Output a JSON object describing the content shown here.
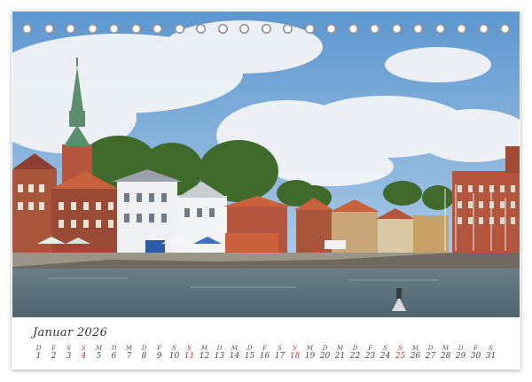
{
  "calendar": {
    "month_label": "Januar 2026",
    "ring_count": 23,
    "sunday_color": "#c0392b",
    "days": [
      {
        "wd": "D",
        "n": "1"
      },
      {
        "wd": "F",
        "n": "2"
      },
      {
        "wd": "S",
        "n": "3"
      },
      {
        "wd": "S",
        "n": "4",
        "sunday": true
      },
      {
        "wd": "M",
        "n": "5"
      },
      {
        "wd": "D",
        "n": "6"
      },
      {
        "wd": "M",
        "n": "7"
      },
      {
        "wd": "D",
        "n": "8"
      },
      {
        "wd": "F",
        "n": "9"
      },
      {
        "wd": "S",
        "n": "10"
      },
      {
        "wd": "S",
        "n": "11",
        "sunday": true
      },
      {
        "wd": "M",
        "n": "12"
      },
      {
        "wd": "D",
        "n": "13"
      },
      {
        "wd": "M",
        "n": "14"
      },
      {
        "wd": "D",
        "n": "15"
      },
      {
        "wd": "F",
        "n": "16"
      },
      {
        "wd": "S",
        "n": "17"
      },
      {
        "wd": "S",
        "n": "18",
        "sunday": true
      },
      {
        "wd": "M",
        "n": "19"
      },
      {
        "wd": "D",
        "n": "20"
      },
      {
        "wd": "M",
        "n": "21"
      },
      {
        "wd": "D",
        "n": "22"
      },
      {
        "wd": "F",
        "n": "23"
      },
      {
        "wd": "S",
        "n": "24"
      },
      {
        "wd": "S",
        "n": "25",
        "sunday": true
      },
      {
        "wd": "M",
        "n": "26"
      },
      {
        "wd": "D",
        "n": "27"
      },
      {
        "wd": "M",
        "n": "28"
      },
      {
        "wd": "D",
        "n": "29"
      },
      {
        "wd": "F",
        "n": "30"
      },
      {
        "wd": "S",
        "n": "31"
      }
    ]
  },
  "colors": {
    "sky": "#7fb0dc",
    "water": "#5f7480",
    "brick": "#b4563e",
    "roof": "#c8613c",
    "spire": "#5c8e6e",
    "trees": "#3f6a2c"
  }
}
